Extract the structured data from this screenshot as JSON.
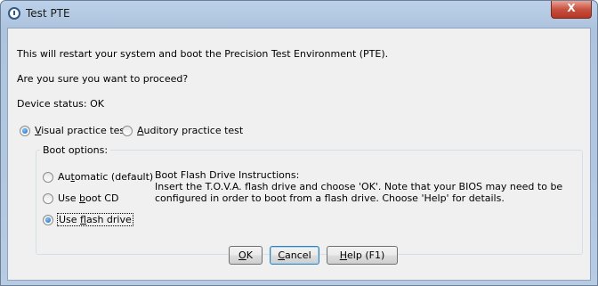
{
  "window": {
    "title": "Test PTE",
    "close_symbol": "X"
  },
  "message": {
    "line1": "This will restart your system and boot the Precision Test Environment (PTE).",
    "line2": "Are you sure you want to proceed?",
    "status": "Device status: OK"
  },
  "test_type": {
    "visual": {
      "mnemonic": "V",
      "rest": "isual practice test",
      "checked": true
    },
    "auditory": {
      "mnemonic": "A",
      "rest": "uditory practice test",
      "checked": false
    }
  },
  "boot_options": {
    "legend": "Boot options:",
    "automatic": {
      "pre": "Au",
      "mnemonic": "t",
      "post": "omatic (default)",
      "checked": false
    },
    "boot_cd": {
      "pre": "Use ",
      "mnemonic": "b",
      "post": "oot CD",
      "checked": false
    },
    "flash_drive": {
      "pre": "Use ",
      "mnemonic": "f",
      "post": "lash drive",
      "checked": true
    },
    "instructions_title": "Boot Flash Drive Instructions:",
    "instructions_body": "Insert the T.O.V.A. flash drive and choose 'OK'. Note that your BIOS may need to be configured in order to boot from a flash drive. Choose 'Help' for details."
  },
  "buttons": {
    "ok": {
      "mnemonic": "O",
      "rest": "K"
    },
    "cancel": {
      "mnemonic": "C",
      "rest": "ancel"
    },
    "help": {
      "mnemonic": "H",
      "rest": "elp (F1)"
    }
  }
}
